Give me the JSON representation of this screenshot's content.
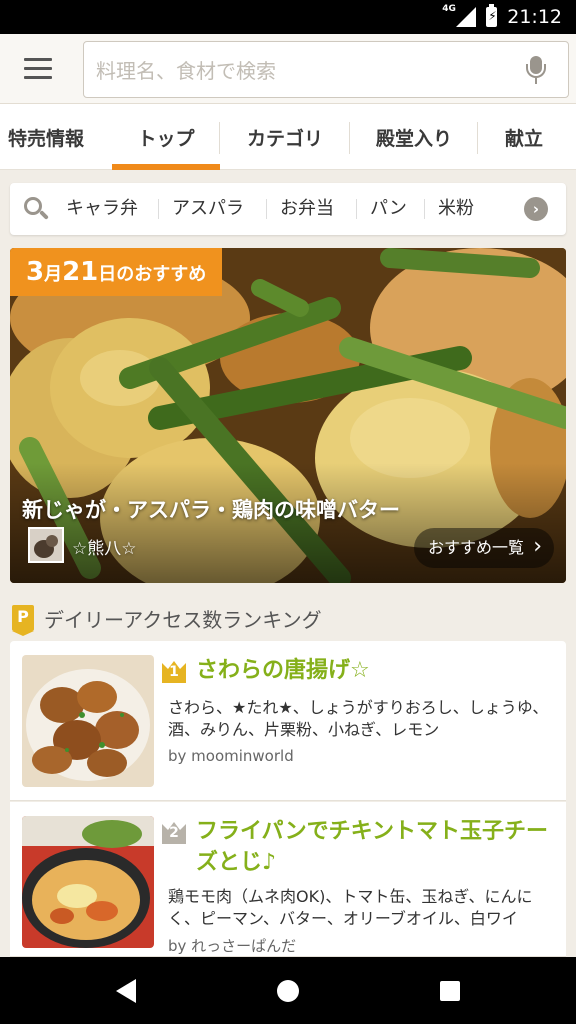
{
  "status_bar": {
    "network": "4G",
    "time": "21:12"
  },
  "search": {
    "placeholder": "料理名、食材で検索"
  },
  "tabs": [
    {
      "label": "特売情報"
    },
    {
      "label": "トップ"
    },
    {
      "label": "カテゴリ"
    },
    {
      "label": "殿堂入り"
    },
    {
      "label": "献立"
    }
  ],
  "active_tab": "トップ",
  "accent_color": "#f08a1a",
  "keywords": [
    "キャラ弁",
    "アスパラ",
    "お弁当",
    "パン",
    "米粉"
  ],
  "featured": {
    "date_month": "3",
    "month_unit": "月",
    "date_day": "21",
    "day_suffix": "日のおすすめ",
    "title": "新じゃが・アスパラ・鶏肉の味噌バター",
    "author": "☆熊八☆",
    "more_label": "おすすめ一覧"
  },
  "ranking": {
    "badge": "P",
    "title": "デイリーアクセス数ランキング",
    "items": [
      {
        "rank": "1",
        "title": "さわらの唐揚げ☆",
        "ingredients": "さわら、★たれ★、しょうがすりおろし、しょうゆ、酒、みりん、片栗粉、小ねぎ、レモン",
        "author": "by moominworld",
        "rank_color": "#e6b422"
      },
      {
        "rank": "2",
        "title": "フライパンでチキントマト玉子チーズとじ♪",
        "ingredients": "鶏モモ肉（ムネ肉OK)、トマト缶、玉ねぎ、にんにく、ピーマン、バター、オリーブオイル、白ワイ",
        "author": "by れっさーぱんだ",
        "rank_color": "#b7b2a9"
      }
    ]
  }
}
